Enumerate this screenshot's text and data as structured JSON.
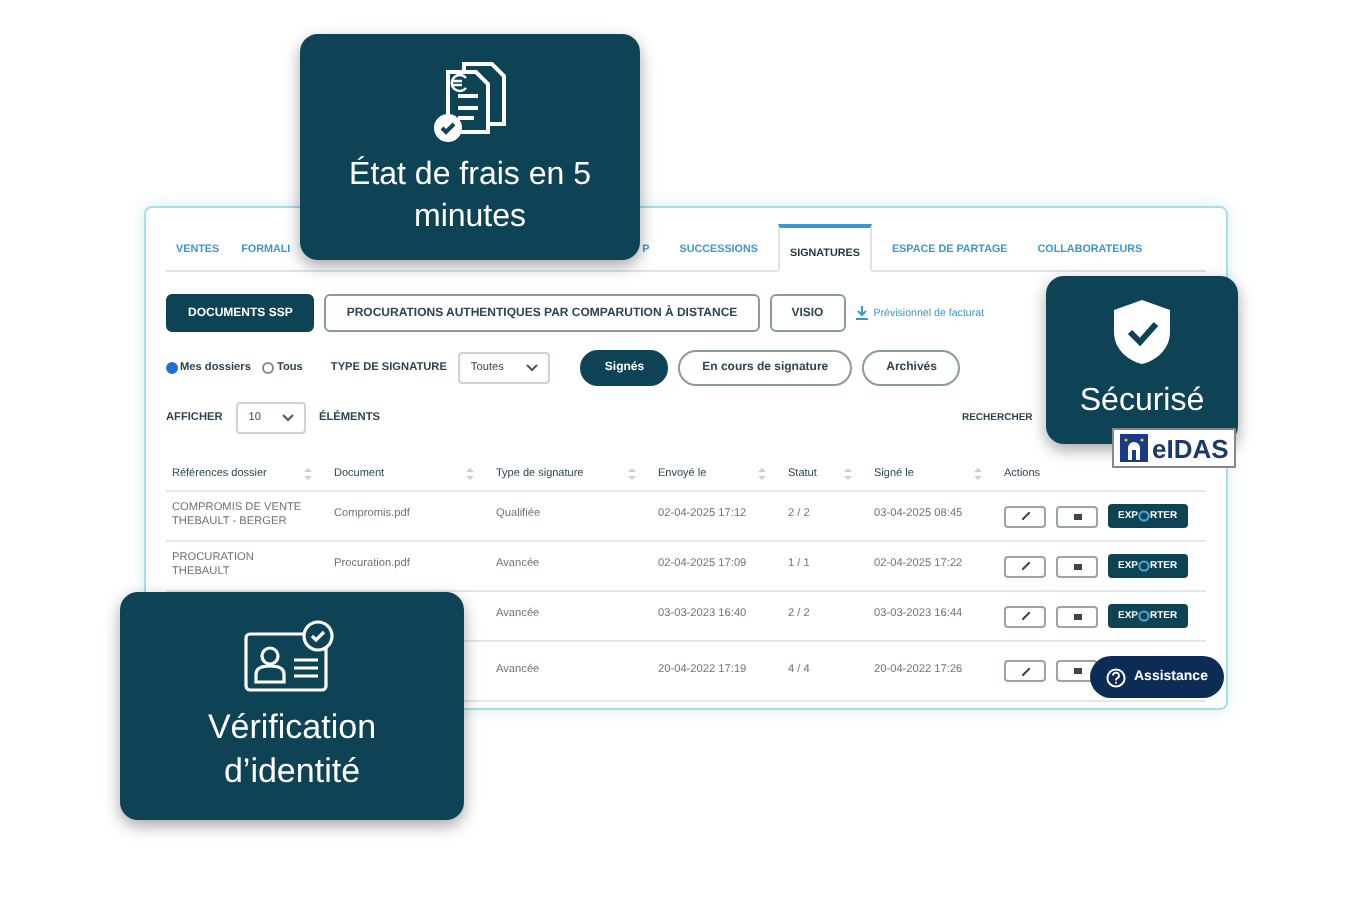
{
  "tabs": [
    {
      "label": "VENTES",
      "selected": false
    },
    {
      "label": "FORMALI",
      "selected": false
    },
    {
      "label": "P",
      "selected": false
    },
    {
      "label": "SUCCESSIONS",
      "selected": false
    },
    {
      "label": "SIGNATURES",
      "selected": true
    },
    {
      "label": "ESPACE DE PARTAGE",
      "selected": false
    },
    {
      "label": "COLLABORATEURS",
      "selected": false
    }
  ],
  "doc_buttons": [
    {
      "label": "DOCUMENTS SSP",
      "selected": true
    },
    {
      "label": "PROCURATIONS AUTHENTIQUES PAR COMPARUTION À DISTANCE",
      "selected": false
    },
    {
      "label": "VISIO",
      "selected": false
    }
  ],
  "billing_link": "Prévisionnel de facturat",
  "scope_options": [
    {
      "label": "Mes dossiers",
      "selected": true
    },
    {
      "label": "Tous",
      "selected": false
    }
  ],
  "signature_type": {
    "label": "TYPE DE SIGNATURE",
    "value": "Toutes"
  },
  "status_filters": [
    {
      "label": "Signés",
      "selected": true
    },
    {
      "label": "En cours de signature",
      "selected": false
    },
    {
      "label": "Archivés",
      "selected": false
    }
  ],
  "page_size": {
    "before": "AFFICHER",
    "value": "10",
    "after": "ÉLÉMENTS"
  },
  "search_label": "RECHERCHER",
  "table": {
    "columns": [
      "Références dossier",
      "Document",
      "Type de signature",
      "Envoyé le",
      "Statut",
      "Signé le",
      "Actions"
    ],
    "rows": [
      {
        "reference": "COMPROMIS DE VENTE THEBAULT - BERGER",
        "document": "Compromis.pdf",
        "type": "Qualifiée",
        "sent": "02-04-2025 17:12",
        "status": "2 / 2",
        "signed": "03-04-2025 08:45",
        "export_label": {
          "start": "EXP",
          "end": "RTER"
        }
      },
      {
        "reference": "PROCURATION THEBAULT",
        "document": "Procuration.pdf",
        "type": "Avancée",
        "sent": "02-04-2025 17:09",
        "status": "1 / 1",
        "signed": "02-04-2025 17:22",
        "export_label": {
          "start": "EXP",
          "end": "RTER"
        }
      },
      {
        "type": "Avancée",
        "sent": "03-03-2023 16:40",
        "status": "2 / 2",
        "signed": "03-03-2023 16:44",
        "export_label": {
          "start": "EXP",
          "end": "RTER"
        }
      },
      {
        "type": "Avancée",
        "sent": "20-04-2022 17:19",
        "status": "4 / 4",
        "signed": "20-04-2022 17:26"
      }
    ]
  },
  "callouts": [
    {
      "kind": "invoice",
      "text": "État de frais en 5 minutes"
    },
    {
      "kind": "shield",
      "text": "Sécurisé",
      "badge": "eIDAS"
    },
    {
      "kind": "id",
      "text": "Vérification d’identité"
    }
  ],
  "assistance": "Assistance"
}
